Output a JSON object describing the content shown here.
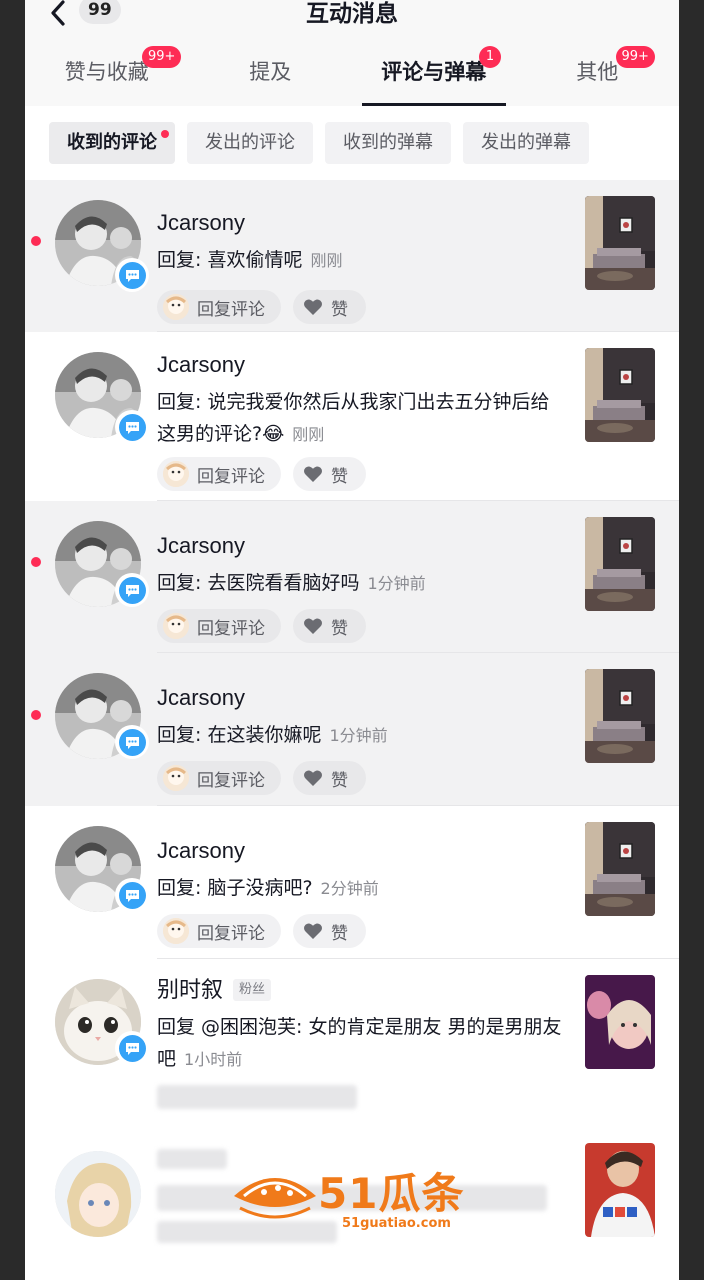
{
  "header": {
    "back_count": "99",
    "title": "互动消息"
  },
  "tabs": [
    {
      "label": "赞与收藏",
      "badge": "99+",
      "active": false
    },
    {
      "label": "提及",
      "badge": "",
      "active": false
    },
    {
      "label": "评论与弹幕",
      "badge": "1",
      "active": true
    },
    {
      "label": "其他",
      "badge": "99+",
      "active": false
    }
  ],
  "chips": [
    {
      "label": "收到的评论",
      "active": true
    },
    {
      "label": "发出的评论",
      "active": false
    },
    {
      "label": "收到的弹幕",
      "active": false
    },
    {
      "label": "发出的弹幕",
      "active": false
    }
  ],
  "actions": {
    "reply_label": "回复评论",
    "like_label": "赞"
  },
  "notifications": [
    {
      "username": "Jcarsony",
      "tag": "",
      "text": "回复: 喜欢偷情呢",
      "time": "刚刚",
      "unread": true
    },
    {
      "username": "Jcarsony",
      "tag": "",
      "text": "回复: 说完我爱你然后从我家门出去五分钟后给这男的评论?😂",
      "time": "刚刚",
      "unread": false
    },
    {
      "username": "Jcarsony",
      "tag": "",
      "text": "回复: 去医院看看脑好吗",
      "time": "1分钟前",
      "unread": true
    },
    {
      "username": "Jcarsony",
      "tag": "",
      "text": "回复: 在这装你嫲呢",
      "time": "1分钟前",
      "unread": true
    },
    {
      "username": "Jcarsony",
      "tag": "",
      "text": "回复: 脑子没病吧?",
      "time": "2分钟前",
      "unread": false
    },
    {
      "username": "别时叙",
      "tag": "粉丝",
      "text": "回复 @困困泡芙: 女的肯定是朋友 男的是男朋友吧",
      "time": "1小时前",
      "unread": false
    }
  ],
  "watermark": {
    "text": "51瓜条",
    "sub": "51guatiao.com"
  },
  "colors": {
    "accent": "#fe2c55",
    "comment_badge": "#35a3f7",
    "watermark": "#f07a1a"
  }
}
